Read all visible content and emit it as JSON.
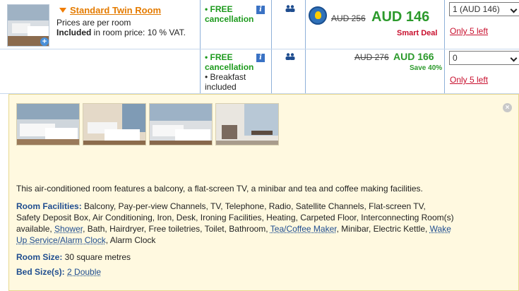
{
  "room": {
    "title": "Standard Twin Room",
    "prices_note": "Prices are per room",
    "vat_prefix": "Included",
    "vat_suffix": " in room price: 10 % VAT."
  },
  "offers": [
    {
      "cancel_label": "• FREE",
      "cancel_label2": "cancellation",
      "old_price": "AUD 256",
      "new_price": "AUD 146",
      "tag": "Smart Deal",
      "select_value": "1 (AUD 146)",
      "availability": "Only 5 left"
    },
    {
      "cancel_label": "• FREE",
      "cancel_label2": "cancellation",
      "breakfast1": "• Breakfast",
      "breakfast2": "included",
      "old_price": "AUD 276",
      "new_price": "AUD 166",
      "tag": "Save 40%",
      "select_value": "0",
      "availability": "Only 5 left"
    }
  ],
  "details": {
    "description": "This air-conditioned room features a balcony, a flat-screen TV, a minibar and tea and coffee making facilities.",
    "facilities_label": "Room Facilities:",
    "facilities_line1": "Balcony, Pay-per-view Channels, TV, Telephone, Radio, Satellite Channels, Flat-screen TV,",
    "facilities_line2": "Safety Deposit Box, Air Conditioning, Iron, Desk, Ironing Facilities, Heating, Carpeted Floor, Interconnecting Room(s)",
    "facilities_line3a": "available,",
    "shower": "Shower",
    "facilities_line3b": ", Bath, Hairdryer, Free toiletries, Toilet, Bathroom,",
    "tea": "Tea/Coffee Maker",
    "facilities_line3c": ", Minibar, Electric Kettle,",
    "wake": "Wake",
    "wake2": "Up Service/Alarm Clock",
    "facilities_line4b": ", Alarm Clock",
    "size_label": "Room Size:",
    "size_value": " 30 square metres",
    "bed_label": "Bed Size(s):",
    "bed_value": "2 Double"
  },
  "icons": {
    "info": "info-icon",
    "people": "two-people-icon",
    "deal": "lightbulb-deal-icon",
    "close": "close-icon"
  }
}
